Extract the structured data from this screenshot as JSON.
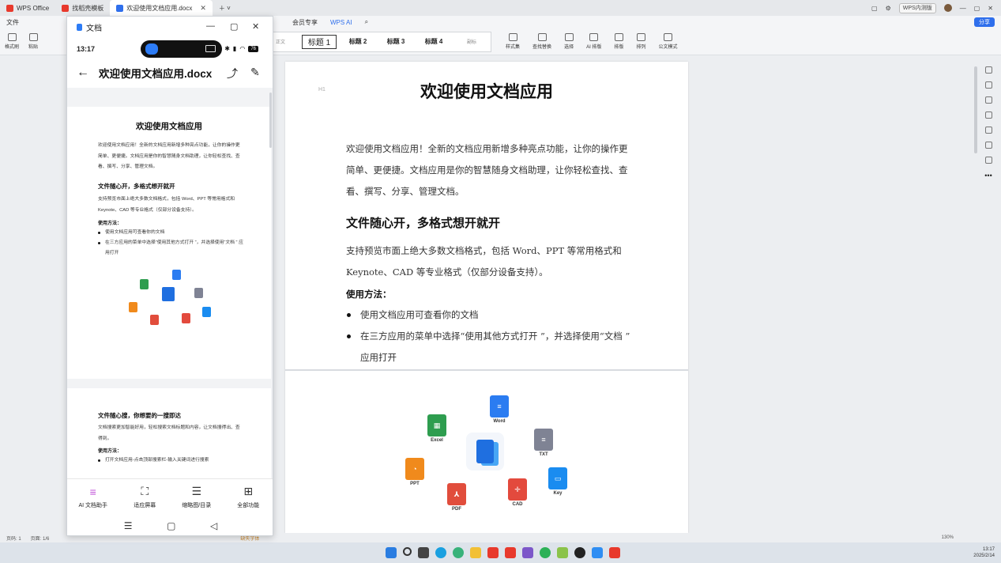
{
  "titlebar": {
    "tabs": [
      {
        "label": "WPS Office",
        "color": "#e8392c"
      },
      {
        "label": "找稻壳模板",
        "color": "#e8392c"
      },
      {
        "label": "欢迎使用文档应用.docx",
        "color": "#2f6fec"
      }
    ],
    "account": "WPS内测版"
  },
  "menu": {
    "file": "文件",
    "member": "会员专享",
    "wps_ai": "WPS AI",
    "share": "分享"
  },
  "ribbon": {
    "format_brush": "格式刷",
    "paste": "粘贴",
    "styles": [
      "正文",
      "标题 1",
      "标题 2",
      "标题 3",
      "标题 4",
      "副标"
    ],
    "tools": [
      "样式集",
      "查找替换",
      "选择",
      "AI 排版",
      "排版",
      "排列",
      "公文模式"
    ]
  },
  "document": {
    "title": "欢迎使用文档应用",
    "para1": "欢迎使用文档应用！全新的文档应用新增多种亮点功能，让你的操作更简单、更便捷。文档应用是你的智慧随身文档助理，让你轻松查找、查看、撰写、分享、管理文档。",
    "h2": "文件随心开，多格式想开就开",
    "para2": "支持预览市面上绝大多数文档格式，包括 Word、PPT 等常用格式和 Keynote、CAD 等专业格式（仅部分设备支持）。",
    "usage": "使用方法：",
    "bullets": [
      "使用文档应用可查看你的文档",
      "在三方应用的菜单中选择“使用其他方式打开 ”，并选择使用“文档 ” 应用打开"
    ],
    "h_mark": "H1"
  },
  "icons": [
    {
      "label": "Word",
      "color": "#2b7cf1",
      "glyph": "≡"
    },
    {
      "label": "Excel",
      "color": "#2e9d4f",
      "glyph": "▦"
    },
    {
      "label": "TXT",
      "color": "#7f8394",
      "glyph": "≡"
    },
    {
      "label": "PPT",
      "color": "#f08a1c",
      "glyph": "◔"
    },
    {
      "label": "Key",
      "color": "#1a8cf0",
      "glyph": "▭"
    },
    {
      "label": "CAD",
      "color": "#e34a3d",
      "glyph": "✛"
    },
    {
      "label": "PDF",
      "color": "#e14d3c",
      "glyph": "⅄"
    }
  ],
  "phone": {
    "app_name": "文档",
    "time": "13:17",
    "battery": "76",
    "file_title": "欢迎使用文档应用.docx",
    "page2_heading": "文件随心搜，你想要的一搜即达",
    "page2_para": "文档搜索更加智能好用，轻松搜索文档标题和内容，让文档搜得出、查得到。",
    "page2_usage": "使用方法：",
    "page2_bullet": "打开文档应用-点击顶部搜索栏-输入关键词进行搜索",
    "bottom": [
      "AI 文档助手",
      "适应屏幕",
      "缩略图/目录",
      "全部功能"
    ]
  },
  "status": {
    "page": "页码: 1",
    "pages": "页面: 1/6",
    "missing_font": "缺失字体",
    "zoom": "130%"
  },
  "clock": {
    "time": "13:17",
    "date": "2025/2/14"
  },
  "colors": {
    "accent": "#2f6fec"
  }
}
